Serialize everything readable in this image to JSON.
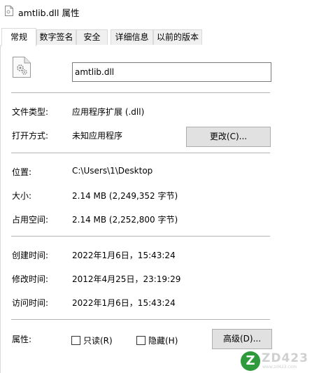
{
  "window": {
    "title": "amtlib.dll 属性",
    "title_icon": "dll-file-icon"
  },
  "tabs": [
    {
      "label": "常规",
      "active": true
    },
    {
      "label": "数字签名",
      "active": false
    },
    {
      "label": "安全",
      "active": false
    },
    {
      "label": "详细信息",
      "active": false
    },
    {
      "label": "以前的版本",
      "active": false
    }
  ],
  "general": {
    "file_icon": "dll-file-icon",
    "file_name": "amtlib.dll",
    "file_type_label": "文件类型:",
    "file_type_value": "应用程序扩展 (.dll)",
    "opens_with_label": "打开方式:",
    "opens_with_value": "未知应用程序",
    "change_button": "更改(C)...",
    "location_label": "位置:",
    "location_value": "C:\\Users\\1\\Desktop",
    "size_label": "大小:",
    "size_value": "2.14 MB (2,249,352 字节)",
    "size_on_disk_label": "占用空间:",
    "size_on_disk_value": "2.14 MB (2,252,800 字节)",
    "created_label": "创建时间:",
    "created_value": "2022年1月6日，15:43:24",
    "modified_label": "修改时间:",
    "modified_value": "2012年4月25日，23:19:29",
    "accessed_label": "访问时间:",
    "accessed_value": "2022年1月6日，15:43:24",
    "attributes_label": "属性:",
    "readonly_label": "只读(R)",
    "readonly_checked": false,
    "hidden_label": "隐藏(H)",
    "hidden_checked": false,
    "advanced_button": "高级(D)..."
  },
  "watermark": {
    "logo_letter": "Z",
    "text": "ZD423",
    "sub": "www.zd423.com"
  },
  "colors": {
    "button_bg": "#e1e1e1",
    "separator": "#b4b4b4",
    "watermark_green": "#2e9a3c"
  }
}
